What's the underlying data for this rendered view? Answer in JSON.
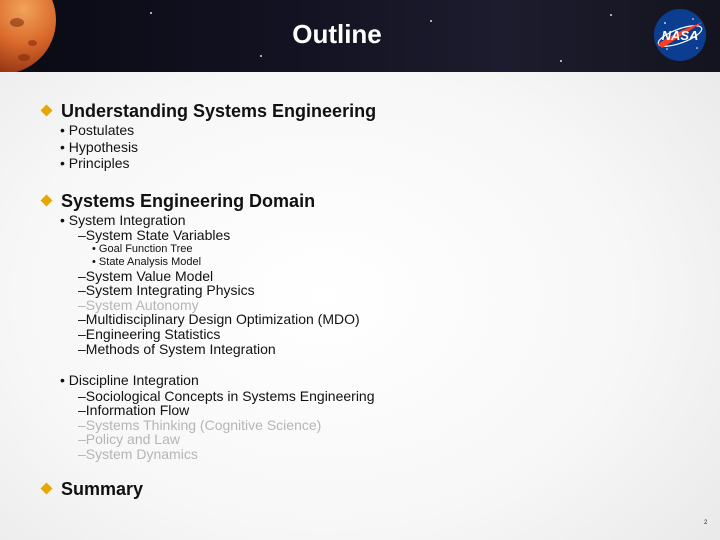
{
  "header": {
    "title": "Outline",
    "logo_text": "NASA"
  },
  "sections": [
    {
      "title": "Understanding Systems Engineering",
      "items": [
        "Postulates",
        "Hypothesis",
        "Principles"
      ]
    },
    {
      "title": "Systems Engineering Domain",
      "system_integration": {
        "label": "System Integration",
        "state_variables": "System State Variables",
        "sub_items": [
          "Goal Function Tree",
          "State Analysis Model"
        ],
        "items": [
          "System Value Model",
          "System Integrating Physics",
          "System Autonomy",
          "Multidisciplinary Design Optimization (MDO)",
          "Engineering Statistics",
          "Methods of System Integration"
        ]
      },
      "discipline_integration": {
        "label": "Discipline Integration",
        "items": [
          "Sociological Concepts in Systems Engineering",
          "Information Flow",
          "Systems Thinking (Cognitive Science)",
          "Policy and Law",
          "System Dynamics"
        ]
      }
    },
    {
      "title": "Summary"
    }
  ],
  "markers": {
    "dot": "•",
    "dash": "–"
  },
  "colors": {
    "header_bg": "#121222",
    "bullet": "#e6a800",
    "grey_text": "#b5b5b5",
    "nasa_blue": "#0b3d91",
    "nasa_red": "#fc3d21"
  },
  "page_number": "2"
}
